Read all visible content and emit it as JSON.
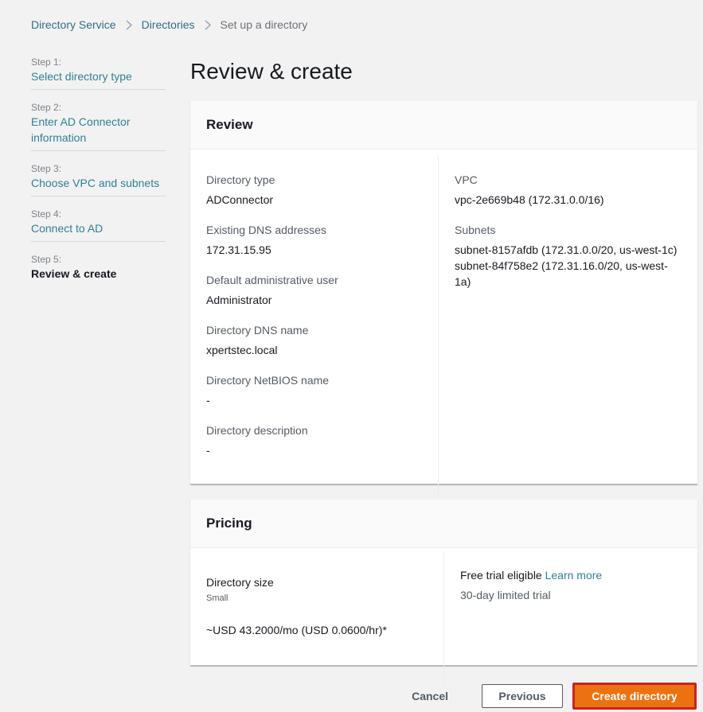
{
  "breadcrumb": {
    "items": [
      "Directory Service",
      "Directories"
    ],
    "current": "Set up a directory"
  },
  "steps": [
    {
      "num": "Step 1:",
      "label": "Select directory type"
    },
    {
      "num": "Step 2:",
      "label": "Enter AD Connector information"
    },
    {
      "num": "Step 3:",
      "label": "Choose VPC and subnets"
    },
    {
      "num": "Step 4:",
      "label": "Connect to AD"
    },
    {
      "num": "Step 5:",
      "label": "Review & create"
    }
  ],
  "page_title": "Review & create",
  "review": {
    "title": "Review",
    "left": [
      {
        "label": "Directory type",
        "value": "ADConnector"
      },
      {
        "label": "Existing DNS addresses",
        "value": "172.31.15.95"
      },
      {
        "label": "Default administrative user",
        "value": "Administrator"
      },
      {
        "label": "Directory DNS name",
        "value": "xpertstec.local"
      },
      {
        "label": "Directory NetBIOS name",
        "value": "-"
      },
      {
        "label": "Directory description",
        "value": "-"
      }
    ],
    "vpc": {
      "label": "VPC",
      "value": "vpc-2e669b48 (172.31.0.0/16)"
    },
    "subnets": {
      "label": "Subnets",
      "values": [
        "subnet-8157afdb (172.31.0.0/20, us-west-1c)",
        "subnet-84f758e2 (172.31.16.0/20, us-west-1a)"
      ]
    }
  },
  "pricing": {
    "title": "Pricing",
    "size_label": "Directory size",
    "size_value": "Small",
    "price": "~USD 43.2000/mo (USD 0.0600/hr)*",
    "trial_text": "Free trial eligible",
    "learn_more": "Learn more",
    "trial_desc": "30-day limited trial"
  },
  "actions": {
    "cancel": "Cancel",
    "previous": "Previous",
    "create": "Create directory"
  },
  "colors": {
    "link": "#2f8096",
    "primary": "#ec7211",
    "highlight_border": "#d0201e"
  }
}
